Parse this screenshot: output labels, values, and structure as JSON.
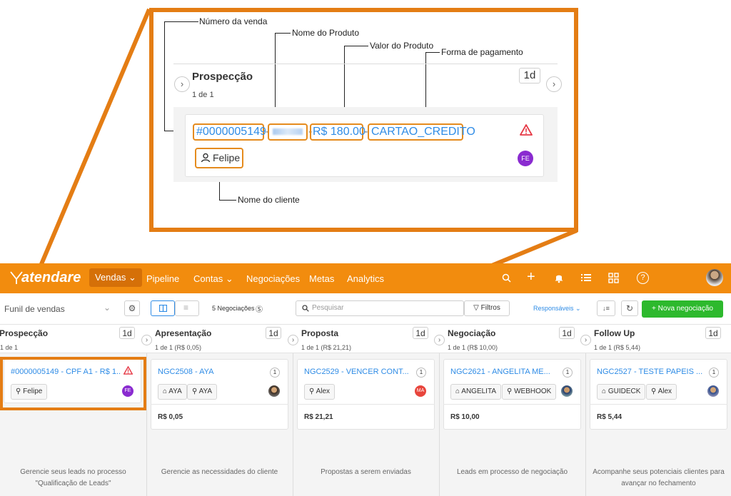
{
  "annotation": {
    "labels": {
      "sale_number": "Número da venda",
      "product_name": "Nome do Produto",
      "product_value": "Valor do Produto",
      "payment_method": "Forma de pagamento",
      "client_name": "Nome do cliente"
    },
    "zoom": {
      "column_title": "Prospecção",
      "column_sub": "1 de 1",
      "day_badge": "1d",
      "sale_number": "#0000005149",
      "value": "R$ 180.00",
      "payment": "CARTAO_CREDITO",
      "client": "Felipe",
      "avatar_initials": "FE",
      "sep": "-"
    }
  },
  "app_bar": {
    "logo": "atendare",
    "vendas": "Vendas",
    "nav": [
      "Pipeline",
      "Contas",
      "Negociações",
      "Metas",
      "Analytics"
    ]
  },
  "toolbar": {
    "funnel": "Funil de vendas",
    "count": "5 Negociações",
    "search_placeholder": "Pesquisar",
    "filters": "Filtros",
    "responsaveis": "Responsáveis",
    "new_deal": "+ Nova negociação"
  },
  "columns": [
    {
      "title": "Prospecção",
      "sub": "1 de 1",
      "day": "1d",
      "card_title": "#0000005149 - CPF A1 - R$ 1..",
      "tags": [
        "Felipe"
      ],
      "avatar": "FE",
      "price": "",
      "desc": "Gerencie seus leads no processo \"Qualificação de Leads\""
    },
    {
      "title": "Apresentação",
      "sub": "1 de 1 (R$ 0,05)",
      "day": "1d",
      "card_title": "NGC2508 - AYA",
      "count": "1",
      "tags": [
        "AYA",
        "AYA"
      ],
      "price": "R$ 0,05",
      "desc": "Gerencie as necessidades do cliente"
    },
    {
      "title": "Proposta",
      "sub": "1 de 1 (R$ 21,21)",
      "day": "1d",
      "card_title": "NGC2529 - VENCER CONT...",
      "count": "1",
      "tags": [
        "Alex"
      ],
      "avatar": "MA",
      "price": "R$ 21,21",
      "desc": "Propostas a serem enviadas"
    },
    {
      "title": "Negociação",
      "sub": "1 de 1 (R$ 10,00)",
      "day": "1d",
      "card_title": "NGC2621 - ANGELITA ME...",
      "count": "1",
      "tags": [
        "ANGELITA",
        "WEBHOOK"
      ],
      "price": "R$ 10,00",
      "desc": "Leads em processo de negociação"
    },
    {
      "title": "Follow Up",
      "sub": "1 de 1 (R$ 5,44)",
      "day": "1d",
      "card_title": "NGC2527 - TESTE PAPEIS ...",
      "count": "1",
      "tags": [
        "GUIDECK",
        "Alex"
      ],
      "price": "R$ 5,44",
      "desc": "Acompanhe seus potenciais clientes para avançar no fechamento"
    }
  ],
  "colors": {
    "accent": "#f28c0e",
    "annotation": "#e47d14",
    "link": "#2f8ce6",
    "green": "#2db92d"
  }
}
